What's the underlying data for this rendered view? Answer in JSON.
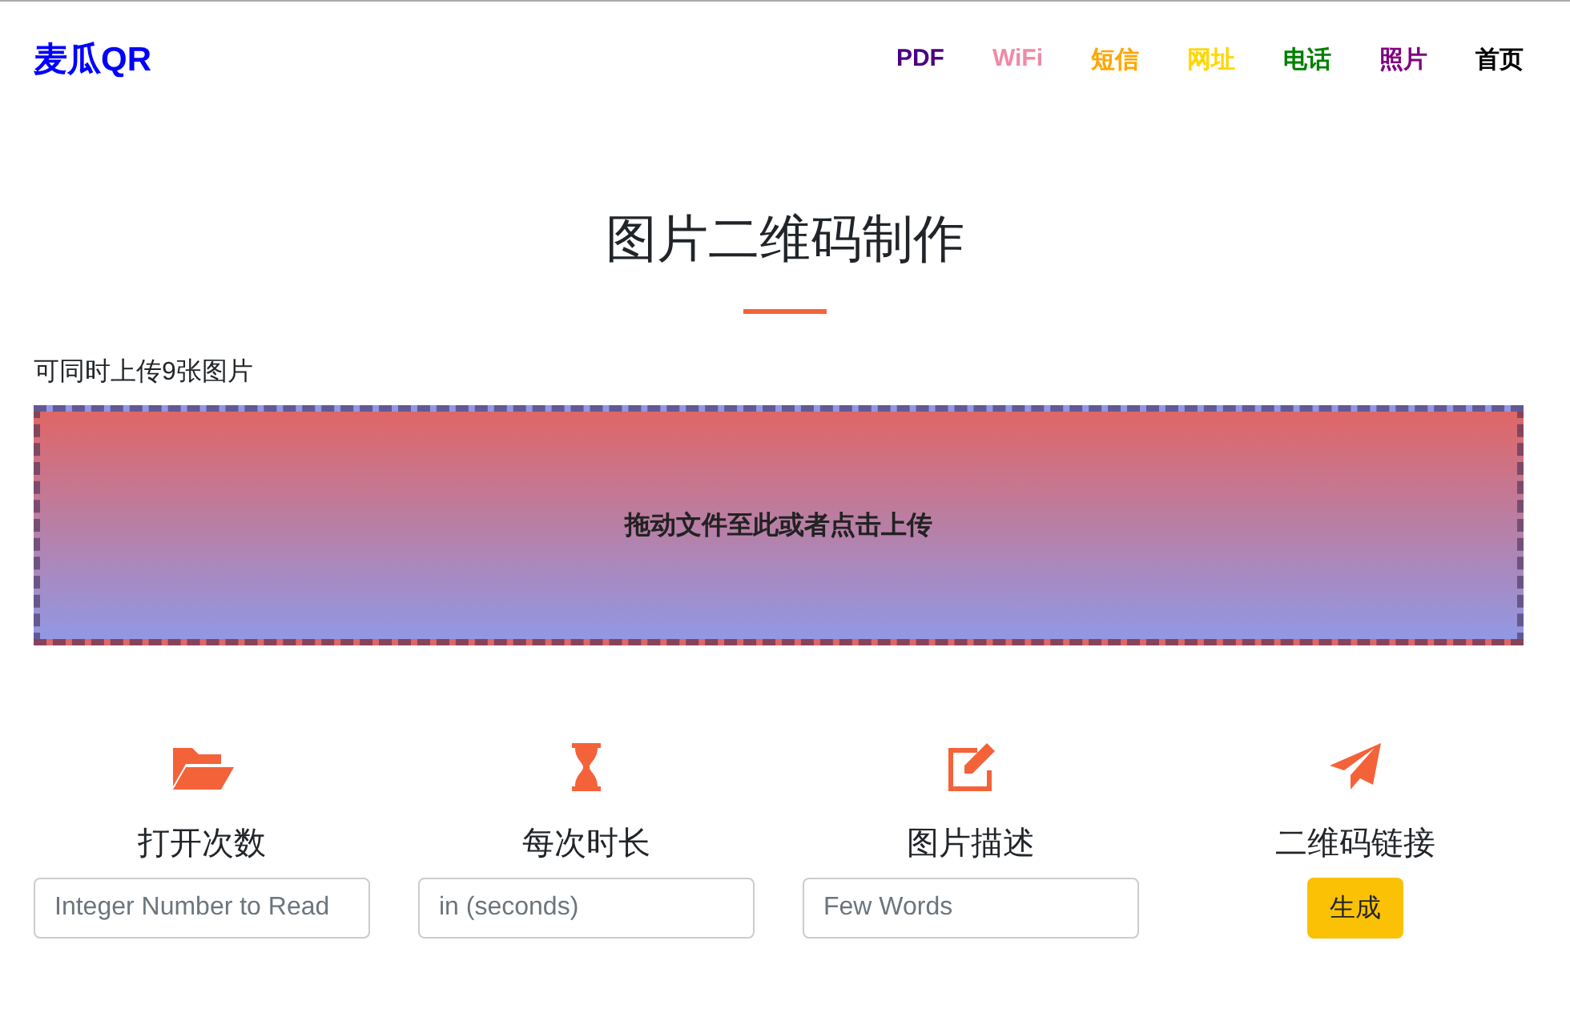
{
  "brand": "麦瓜QR",
  "nav": [
    {
      "label": "PDF",
      "color": "#4b0082"
    },
    {
      "label": "WiFi",
      "color": "#f08aa6"
    },
    {
      "label": "短信",
      "color": "#ffa500"
    },
    {
      "label": "网址",
      "color": "#ffd700"
    },
    {
      "label": "电话",
      "color": "#008000"
    },
    {
      "label": "照片",
      "color": "#800080"
    },
    {
      "label": "首页",
      "color": "#000000"
    }
  ],
  "title": "图片二维码制作",
  "upload": {
    "note": "可同时上传9张图片",
    "drop_text": "拖动文件至此或者点击上传"
  },
  "features": [
    {
      "title": "打开次数",
      "kind": "input",
      "placeholder": "Integer Number to Read"
    },
    {
      "title": "每次时长",
      "kind": "input",
      "placeholder": "in (seconds)"
    },
    {
      "title": "图片描述",
      "kind": "input",
      "placeholder": "Few Words"
    },
    {
      "title": "二维码链接",
      "kind": "button",
      "button": "生成"
    }
  ]
}
